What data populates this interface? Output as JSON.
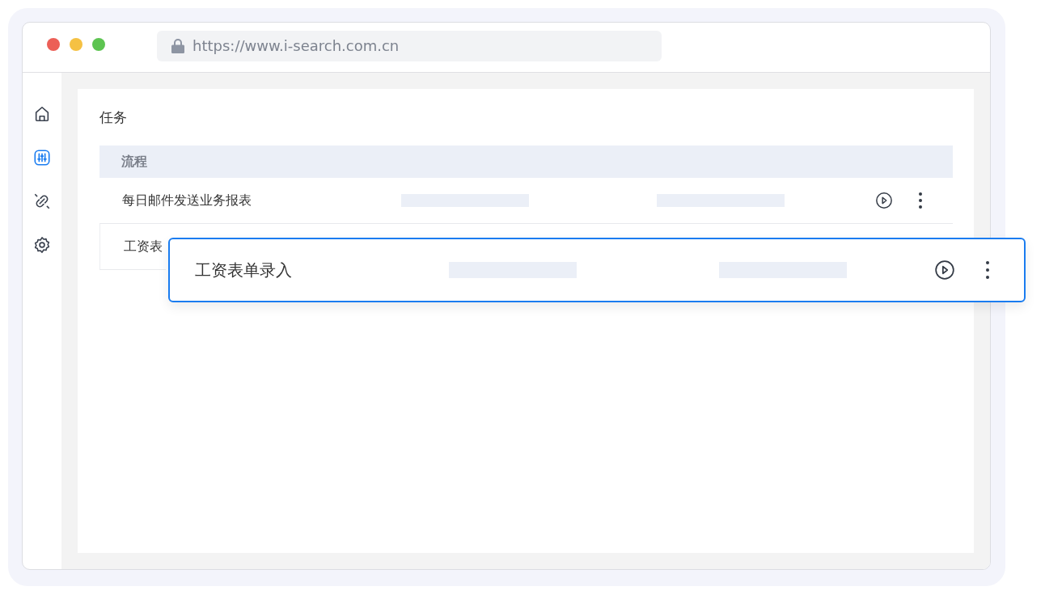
{
  "browser": {
    "url": "https://www.i-search.com.cn"
  },
  "sidebar": {
    "items": [
      {
        "kind": "home",
        "selected": false
      },
      {
        "kind": "sliders",
        "selected": true
      },
      {
        "kind": "link",
        "selected": false
      },
      {
        "kind": "settings",
        "selected": false
      }
    ]
  },
  "page": {
    "title": "任务"
  },
  "table": {
    "columns": [
      "流程"
    ],
    "rows": [
      {
        "name": "每日邮件发送业务报表"
      },
      {
        "name": "工资表"
      }
    ]
  },
  "floating_row": {
    "name": "工资表单录入"
  }
}
